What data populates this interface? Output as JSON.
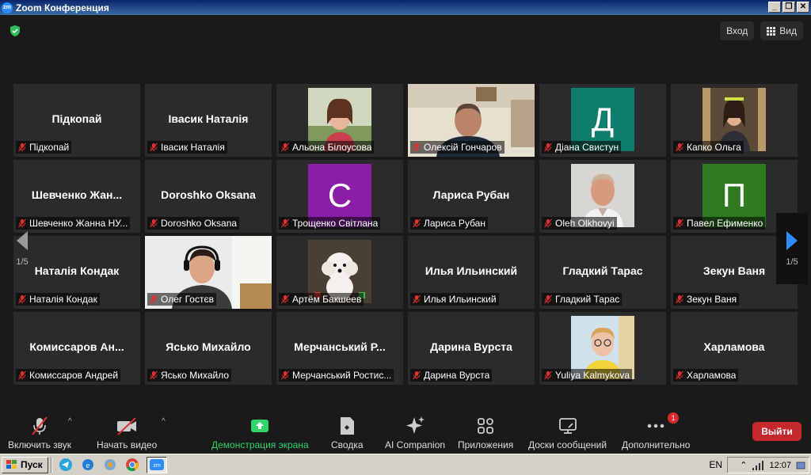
{
  "window": {
    "title": "Zoom Конференция",
    "logo_text": "zm",
    "controls": [
      "_",
      "❐",
      "✕"
    ]
  },
  "header": {
    "enter_label": "Вход",
    "view_label": "Вид"
  },
  "page_indicator": {
    "left": "1/5",
    "right": "1/5"
  },
  "participants": [
    {
      "tile_name": "Підкопай",
      "footer_name": "Підкопай",
      "kind": "name"
    },
    {
      "tile_name": "Івасик Наталія",
      "footer_name": "Івасик Наталія",
      "kind": "name"
    },
    {
      "tile_name": "",
      "footer_name": "Альона Білоусова",
      "kind": "photo",
      "photo": "woman-outdoor"
    },
    {
      "tile_name": "",
      "footer_name": "Олексій Гончаров",
      "kind": "video",
      "active": true
    },
    {
      "tile_name": "",
      "footer_name": "Діана Свистун",
      "kind": "avatar",
      "initial": "Д",
      "color": "#0f7d6b"
    },
    {
      "tile_name": "",
      "footer_name": "Капко Ольга",
      "kind": "photo",
      "photo": "woman-portrait"
    },
    {
      "tile_name": "Шевченко  Жан...",
      "footer_name": "Шевченко Жанна НУ...",
      "kind": "name"
    },
    {
      "tile_name": "Doroshko Oksana",
      "footer_name": "Doroshko Oksana",
      "kind": "name"
    },
    {
      "tile_name": "",
      "footer_name": "Трощенко Світлана",
      "kind": "avatar",
      "initial": "С",
      "color": "#8a1ea8"
    },
    {
      "tile_name": "Лариса   Рубан",
      "footer_name": "Лариса   Рубан",
      "kind": "name"
    },
    {
      "tile_name": "",
      "footer_name": "Oleh Olkhovyi",
      "kind": "photo",
      "photo": "man-portrait"
    },
    {
      "tile_name": "",
      "footer_name": "Павел Ефименко",
      "kind": "avatar",
      "initial": "П",
      "color": "#2f7a1e"
    },
    {
      "tile_name": "Наталія Кондак",
      "footer_name": "Наталія Кондак",
      "kind": "name"
    },
    {
      "tile_name": "",
      "footer_name": "Олег Гостєв",
      "kind": "video2"
    },
    {
      "tile_name": "",
      "footer_name": "Артём Бакшеев",
      "kind": "photo",
      "photo": "dog"
    },
    {
      "tile_name": "Илья Ильинский",
      "footer_name": "Илья Ильинский",
      "kind": "name"
    },
    {
      "tile_name": "Гладкий Тарас",
      "footer_name": "Гладкий Тарас",
      "kind": "name"
    },
    {
      "tile_name": "Зекун Ваня",
      "footer_name": "Зекун Ваня",
      "kind": "name"
    },
    {
      "tile_name": "Комиссаров  Ан...",
      "footer_name": "Комиссаров Андрей",
      "kind": "name"
    },
    {
      "tile_name": "Ясько Михайло",
      "footer_name": "Ясько Михайло",
      "kind": "name"
    },
    {
      "tile_name": "Мерчанський  Р...",
      "footer_name": "Мерчанський Ростис...",
      "kind": "name"
    },
    {
      "tile_name": "Дарина Вурста",
      "footer_name": "Дарина Вурста",
      "kind": "name"
    },
    {
      "tile_name": "",
      "footer_name": "Yuliya Kalmykova",
      "kind": "photo",
      "photo": "woman-glasses"
    },
    {
      "tile_name": "Харламова",
      "footer_name": "Харламова",
      "kind": "name"
    }
  ],
  "toolbar": {
    "unmute": "Включить звук",
    "start_video": "Начать видео",
    "share_screen": "Демонстрация экрана",
    "summary": "Сводка",
    "ai_companion": "AI Companion",
    "apps": "Приложения",
    "whiteboards": "Доски сообщений",
    "more": "Дополнительно",
    "more_badge": "1",
    "leave": "Выйти"
  },
  "taskbar": {
    "start_label": "Пуск",
    "language": "EN",
    "time": "12:07"
  },
  "colors": {
    "accent_green": "#2fd46b",
    "leave_red": "#c4272c",
    "active_speaker": "#d7e06a"
  }
}
